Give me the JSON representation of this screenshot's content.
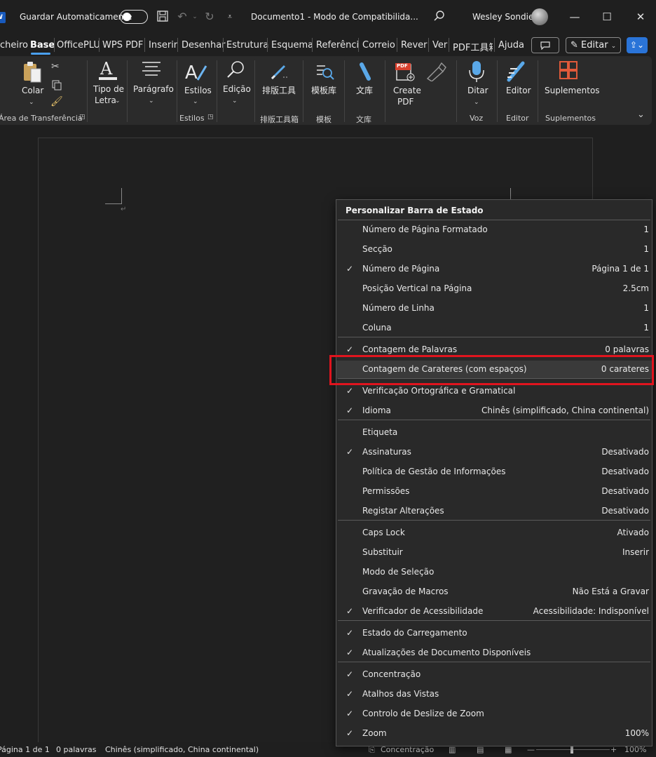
{
  "titlebar": {
    "logo": "W",
    "autosave_label": "Guardar Automaticamente",
    "document_title": "Documento1  -  Modo de Compatibilida...",
    "user_name": "Wesley Sondie"
  },
  "tabs": [
    "cheiro",
    "Base",
    "OfficePLU",
    "WPS PDF",
    "Inserir",
    "Desenhar",
    "Estrutura",
    "Esquema",
    "Referênci",
    "Correio",
    "Rever",
    "Ver",
    "PDF工具箱",
    "Ajuda"
  ],
  "active_tab": "Base",
  "edit_button": "Editar",
  "ribbon": {
    "colar": "Colar",
    "tipo_letra_1": "Tipo de",
    "tipo_letra_2": "Letra",
    "paragrafo": "Parágrafo",
    "estilos": "Estilos",
    "edicao": "Edição",
    "paiban": "排版工具",
    "mobanku": "模板库",
    "wenku": "文库",
    "create_pdf_1": "Create",
    "create_pdf_2": "PDF",
    "pdf_badge": "PDF",
    "ditar": "Ditar",
    "editor": "Editor",
    "suplementos": "Suplementos",
    "group_clipboard": "Área de Transferência",
    "group_estilos": "Estilos",
    "group_paiban": "排版工具箱",
    "group_moban": "模板",
    "group_wenku": "文库",
    "group_voz": "Voz",
    "group_editor": "Editor",
    "group_suplementos": "Suplementos"
  },
  "statusbar": {
    "page": "Página 1 de 1",
    "words": "0 palavras",
    "language": "Chinês (simplificado, China continental)",
    "focus": "Concentração",
    "zoom": "100%"
  },
  "menu": {
    "title": "Personalizar Barra de Estado",
    "items": [
      {
        "checked": false,
        "label": "Número de Página Formatado",
        "value": "1"
      },
      {
        "checked": false,
        "label": "Secção",
        "value": "1"
      },
      {
        "checked": true,
        "label": "Número de Página",
        "value": "Página 1 de 1"
      },
      {
        "checked": false,
        "label": "Posição Vertical na Página",
        "value": "2.5cm"
      },
      {
        "checked": false,
        "label": "Número de Linha",
        "value": "1"
      },
      {
        "checked": false,
        "label": "Coluna",
        "value": "1"
      },
      {
        "checked": true,
        "label": "Contagem de Palavras",
        "value": "0 palavras"
      },
      {
        "checked": false,
        "label": "Contagem de Carateres (com espaços)",
        "value": "0 carateres"
      },
      {
        "checked": true,
        "label": "Verificação Ortográfica e Gramatical",
        "value": ""
      },
      {
        "checked": true,
        "label": "Idioma",
        "value": "Chinês (simplificado, China continental)"
      },
      {
        "checked": false,
        "label": "Etiqueta",
        "value": ""
      },
      {
        "checked": true,
        "label": "Assinaturas",
        "value": "Desativado"
      },
      {
        "checked": false,
        "label": "Política de Gestão de Informações",
        "value": "Desativado"
      },
      {
        "checked": false,
        "label": "Permissões",
        "value": "Desativado"
      },
      {
        "checked": false,
        "label": "Registar Alterações",
        "value": "Desativado"
      },
      {
        "checked": false,
        "label": "Caps Lock",
        "value": "Ativado"
      },
      {
        "checked": false,
        "label": "Substituir",
        "value": "Inserir"
      },
      {
        "checked": false,
        "label": "Modo de Seleção",
        "value": ""
      },
      {
        "checked": false,
        "label": "Gravação de Macros",
        "value": "Não Está a Gravar"
      },
      {
        "checked": true,
        "label": "Verificador de Acessibilidade",
        "value": "Acessibilidade: Indisponível"
      },
      {
        "checked": true,
        "label": "Estado do Carregamento",
        "value": ""
      },
      {
        "checked": true,
        "label": "Atualizações de Documento Disponíveis",
        "value": ""
      },
      {
        "checked": true,
        "label": "Concentração",
        "value": ""
      },
      {
        "checked": true,
        "label": "Atalhos das Vistas",
        "value": ""
      },
      {
        "checked": true,
        "label": "Controlo de Deslize de Zoom",
        "value": ""
      },
      {
        "checked": true,
        "label": "Zoom",
        "value": "100%"
      }
    ]
  }
}
